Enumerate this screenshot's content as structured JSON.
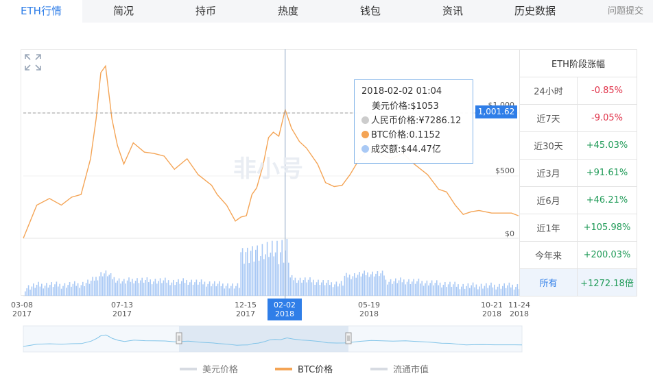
{
  "tabs": [
    {
      "label": "ETH行情",
      "active": true
    },
    {
      "label": "简况"
    },
    {
      "label": "持币"
    },
    {
      "label": "热度"
    },
    {
      "label": "钱包"
    },
    {
      "label": "资讯"
    },
    {
      "label": "历史数据"
    }
  ],
  "feedback_label": "问题提交",
  "watermark": "非小号",
  "tooltip": {
    "date": "2018-02-02 01:04",
    "usd": "美元价格:$1053",
    "cny": "人民币价格:¥7286.12",
    "btc": "BTC价格:0.1152",
    "volume": "成交额:$44.47亿"
  },
  "price_flag": "1,001.62",
  "side_table": {
    "title": "ETH阶段涨幅",
    "rows": [
      {
        "label": "24小时",
        "value": "-0.85%",
        "sign": "neg"
      },
      {
        "label": "近7天",
        "value": "-9.05%",
        "sign": "neg"
      },
      {
        "label": "近30天",
        "value": "+45.03%",
        "sign": "pos"
      },
      {
        "label": "近3月",
        "value": "+91.61%",
        "sign": "pos"
      },
      {
        "label": "近6月",
        "value": "+46.21%",
        "sign": "pos"
      },
      {
        "label": "近1年",
        "value": "+105.98%",
        "sign": "pos"
      },
      {
        "label": "今年来",
        "value": "+200.03%",
        "sign": "pos"
      },
      {
        "label": "所有",
        "value": "+1272.18倍",
        "sign": "pos",
        "active": true
      }
    ]
  },
  "colors": {
    "accent": "#2f7ee8",
    "btc_line": "#f4a455",
    "volume_bar": "#a9c9f5",
    "navigator_line": "#7fc3e8",
    "positive": "#1f9a57",
    "negative": "#e0334a"
  },
  "chart_data": {
    "type": "line",
    "title": "",
    "xlabel": "",
    "ylabel": "",
    "y_axis_visible_labels": [
      "$1,000",
      "$500",
      "$0"
    ],
    "ylim": [
      0,
      1400
    ],
    "x_axis": [
      {
        "date": "03-08",
        "year": "2017"
      },
      {
        "date": "07-13",
        "year": "2017"
      },
      {
        "date": "12-15",
        "year": "2017"
      },
      {
        "date": "02-02",
        "year": "2018",
        "highlight": true
      },
      {
        "date": "05-19",
        "year": "2018"
      },
      {
        "date": "10-21",
        "year": "2018"
      },
      {
        "date": "11-24",
        "year": "2018"
      }
    ],
    "date_range": [
      "2017-03-08",
      "2018-11-24"
    ],
    "crosshair_date": "2018-02-02",
    "crosshair_value": 1001.62,
    "series": [
      {
        "name": "BTC价格",
        "kind": "line",
        "points": [
          [
            "2017-03-08",
            0
          ],
          [
            "2017-03-25",
            250
          ],
          [
            "2017-04-10",
            300
          ],
          [
            "2017-04-25",
            250
          ],
          [
            "2017-05-08",
            310
          ],
          [
            "2017-05-20",
            330
          ],
          [
            "2017-06-01",
            600
          ],
          [
            "2017-06-08",
            900
          ],
          [
            "2017-06-14",
            1250
          ],
          [
            "2017-06-20",
            1300
          ],
          [
            "2017-06-28",
            900
          ],
          [
            "2017-07-05",
            700
          ],
          [
            "2017-07-13",
            560
          ],
          [
            "2017-07-25",
            720
          ],
          [
            "2017-08-08",
            650
          ],
          [
            "2017-08-20",
            640
          ],
          [
            "2017-09-02",
            620
          ],
          [
            "2017-09-15",
            520
          ],
          [
            "2017-10-01",
            600
          ],
          [
            "2017-10-15",
            480
          ],
          [
            "2017-11-01",
            400
          ],
          [
            "2017-11-08",
            330
          ],
          [
            "2017-11-20",
            250
          ],
          [
            "2017-12-01",
            130
          ],
          [
            "2017-12-08",
            160
          ],
          [
            "2017-12-15",
            170
          ],
          [
            "2017-12-22",
            330
          ],
          [
            "2017-12-28",
            380
          ],
          [
            "2018-01-05",
            550
          ],
          [
            "2018-01-12",
            760
          ],
          [
            "2018-01-18",
            800
          ],
          [
            "2018-01-25",
            770
          ],
          [
            "2018-02-02",
            970
          ],
          [
            "2018-02-10",
            830
          ],
          [
            "2018-02-20",
            730
          ],
          [
            "2018-03-01",
            680
          ],
          [
            "2018-03-15",
            560
          ],
          [
            "2018-03-25",
            420
          ],
          [
            "2018-04-05",
            390
          ],
          [
            "2018-04-15",
            400
          ],
          [
            "2018-04-25",
            480
          ],
          [
            "2018-05-05",
            580
          ],
          [
            "2018-05-19",
            680
          ],
          [
            "2018-06-01",
            640
          ],
          [
            "2018-06-15",
            600
          ],
          [
            "2018-07-01",
            640
          ],
          [
            "2018-07-15",
            560
          ],
          [
            "2018-08-01",
            480
          ],
          [
            "2018-08-15",
            370
          ],
          [
            "2018-08-25",
            350
          ],
          [
            "2018-09-05",
            250
          ],
          [
            "2018-09-15",
            180
          ],
          [
            "2018-09-25",
            200
          ],
          [
            "2018-10-05",
            210
          ],
          [
            "2018-10-21",
            190
          ],
          [
            "2018-11-05",
            190
          ],
          [
            "2018-11-15",
            190
          ],
          [
            "2018-11-24",
            170
          ]
        ]
      }
    ],
    "legend": [
      {
        "name": "美元价格",
        "color": "#d7dbe2",
        "enabled": false
      },
      {
        "name": "BTC价格",
        "color": "#f4a455",
        "enabled": true
      },
      {
        "name": "流通市值",
        "color": "#d7dbe2",
        "enabled": false
      }
    ],
    "legend_position": "bottom-center"
  }
}
